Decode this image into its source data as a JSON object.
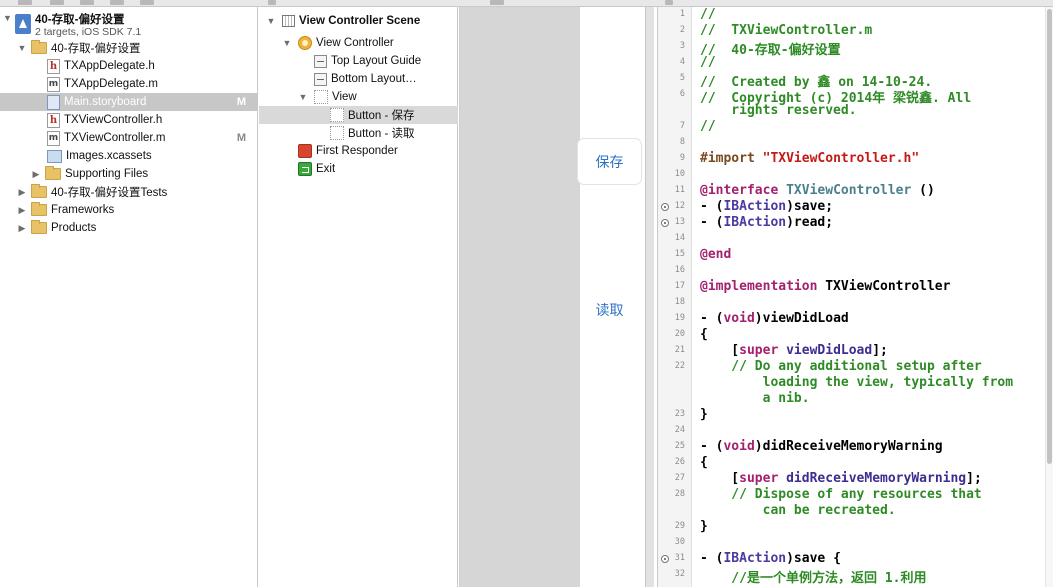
{
  "navigator": {
    "project": {
      "name": "40-存取-偏好设置",
      "subtitle": "2 targets, iOS SDK 7.1"
    },
    "items": [
      {
        "label": "40-存取-偏好设置",
        "kind": "folder",
        "expanded": true
      },
      {
        "label": "TXAppDelegate.h",
        "kind": "h"
      },
      {
        "label": "TXAppDelegate.m",
        "kind": "m"
      },
      {
        "label": "Main.storyboard",
        "kind": "storyboard",
        "badge": "M",
        "selected": true
      },
      {
        "label": "TXViewController.h",
        "kind": "h"
      },
      {
        "label": "TXViewController.m",
        "kind": "m",
        "badge": "M"
      },
      {
        "label": "Images.xcassets",
        "kind": "assets"
      },
      {
        "label": "Supporting Files",
        "kind": "folder"
      },
      {
        "label": "40-存取-偏好设置Tests",
        "kind": "folder"
      },
      {
        "label": "Frameworks",
        "kind": "folder"
      },
      {
        "label": "Products",
        "kind": "folder"
      }
    ]
  },
  "outline": {
    "scene": "View Controller Scene",
    "view_controller": "View Controller",
    "top_guide": "Top Layout Guide",
    "bottom_guide": "Bottom Layout…",
    "view": "View",
    "button_save": "Button - 保存",
    "button_read": "Button - 读取",
    "first_responder": "First Responder",
    "exit": "Exit"
  },
  "canvas": {
    "save_button": "保存",
    "read_button": "读取"
  },
  "editor": {
    "line_numbers": [
      "1",
      "2",
      "3",
      "4",
      "5",
      "6",
      "",
      "7",
      "8",
      "9",
      "10",
      "11",
      "12",
      "13",
      "14",
      "15",
      "16",
      "17",
      "18",
      "19",
      "20",
      "21",
      "22",
      "",
      "",
      "23",
      "24",
      "25",
      "26",
      "27",
      "28",
      "",
      "29",
      "30",
      "31",
      "32"
    ],
    "lines": {
      "l1": "//",
      "l2": "//  TXViewController.m",
      "l3": "//  40-存取-偏好设置",
      "l4": "//",
      "l5": "//  Created by 鑫 on 14-10-24.",
      "l6a": "//  Copyright (c) 2014年 梁锐鑫. All",
      "l6b": "    rights reserved.",
      "l7": "//",
      "l9_kw": "#import",
      "l9_str": " \"TXViewController.h\"",
      "l11_kw": "@interface",
      "l11_cls": " TXViewController",
      "l11_rest": " ()",
      "l12_pre": "- (",
      "l12_type": "IBAction",
      "l12_rest": ")save;",
      "l13_pre": "- (",
      "l13_type": "IBAction",
      "l13_rest": ")read;",
      "l15": "@end",
      "l17_kw": "@implementation",
      "l17_rest": " TXViewController",
      "l19_pre": "- (",
      "l19_type": "void",
      "l19_rest": ")viewDidLoad",
      "l20": "{",
      "l21_pre": "    [",
      "l21_kw": "super",
      "l21_meth": " viewDidLoad",
      "l21_rest": "];",
      "l22a": "    // Do any additional setup after",
      "l22b": "        loading the view, typically from",
      "l22c": "        a nib.",
      "l23": "}",
      "l25_pre": "- (",
      "l25_type": "void",
      "l25_rest": ")didReceiveMemoryWarning",
      "l26": "{",
      "l27_pre": "    [",
      "l27_kw": "super",
      "l27_meth": " didReceiveMemoryWarning",
      "l27_rest": "];",
      "l28a": "    // Dispose of any resources that",
      "l28b": "        can be recreated.",
      "l29": "}",
      "l31_pre": "- (",
      "l31_type": "IBAction",
      "l31_rest": ")save {",
      "l32": "    //是一个单例方法，返回 1.利用"
    }
  },
  "colors": {
    "comment": "#2e8b25",
    "keyword": "#a4206f",
    "type": "#4d3a9e",
    "string": "#c41a16",
    "button_text": "#2f72c4",
    "selection": "#c7c7c7"
  }
}
